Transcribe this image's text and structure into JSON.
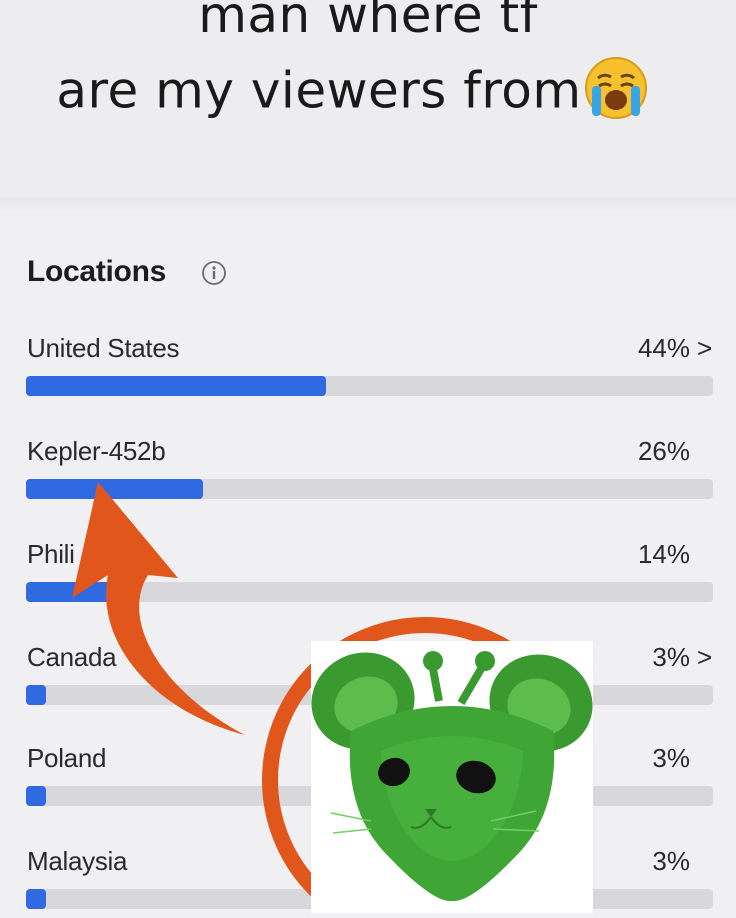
{
  "caption": {
    "line1": "man where tf",
    "line2": "are my viewers from"
  },
  "section": {
    "title": "Locations"
  },
  "locations": [
    {
      "label": "United States",
      "pct": "44%",
      "chevron": ">",
      "share": 0.44
    },
    {
      "label": "Kepler-452b",
      "pct": "26%",
      "chevron": "",
      "share": 0.26
    },
    {
      "label": "Phili",
      "pct": "14%",
      "chevron": "",
      "share": 0.14
    },
    {
      "label": "Canada",
      "pct": "3%",
      "chevron": ">",
      "share": 0.03
    },
    {
      "label": "Poland",
      "pct": "3%",
      "chevron": "",
      "share": 0.03
    },
    {
      "label": "Malaysia",
      "pct": "3%",
      "chevron": "",
      "share": 0.03
    }
  ],
  "colors": {
    "bar_fill": "#2f6ae3",
    "bar_track": "#d8d8dc",
    "annotation": "#e0561b",
    "alien": "#3fa535"
  },
  "icons": {
    "info": "info-circle-icon",
    "emoji": "loudly-crying-face-emoji",
    "arrow": "curved-arrow",
    "circle": "highlight-circle"
  }
}
